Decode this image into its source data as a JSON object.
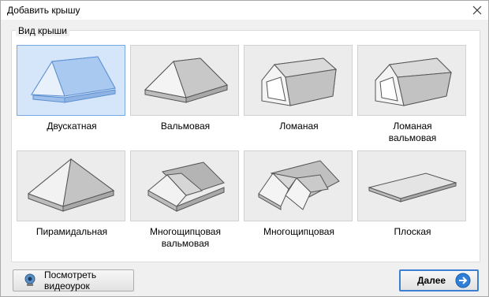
{
  "window": {
    "title": "Добавить крышу"
  },
  "group": {
    "title": "Вид крыши"
  },
  "roof_types": [
    {
      "label": "Двускатная",
      "selected": true,
      "icon": "gable-roof-icon"
    },
    {
      "label": "Вальмовая",
      "selected": false,
      "icon": "hip-roof-icon"
    },
    {
      "label": "Ломаная",
      "selected": false,
      "icon": "gambrel-roof-icon"
    },
    {
      "label": "Ломаная вальмовая",
      "selected": false,
      "icon": "gambrel-hip-roof-icon"
    },
    {
      "label": "Пирамидальная",
      "selected": false,
      "icon": "pyramid-roof-icon"
    },
    {
      "label": "Многощипцовая вальмовая",
      "selected": false,
      "icon": "multi-gable-hip-roof-icon"
    },
    {
      "label": "Многощипцовая",
      "selected": false,
      "icon": "multi-gable-roof-icon"
    },
    {
      "label": "Плоская",
      "selected": false,
      "icon": "flat-roof-icon"
    }
  ],
  "buttons": {
    "video_label": "Посмотреть видеоурок",
    "next_label": "Далее"
  },
  "colors": {
    "selected_tile": "#d5e6fb",
    "selected_border": "#7aa9e0",
    "tile_bg": "#ececec",
    "accent": "#3c7fd0"
  }
}
